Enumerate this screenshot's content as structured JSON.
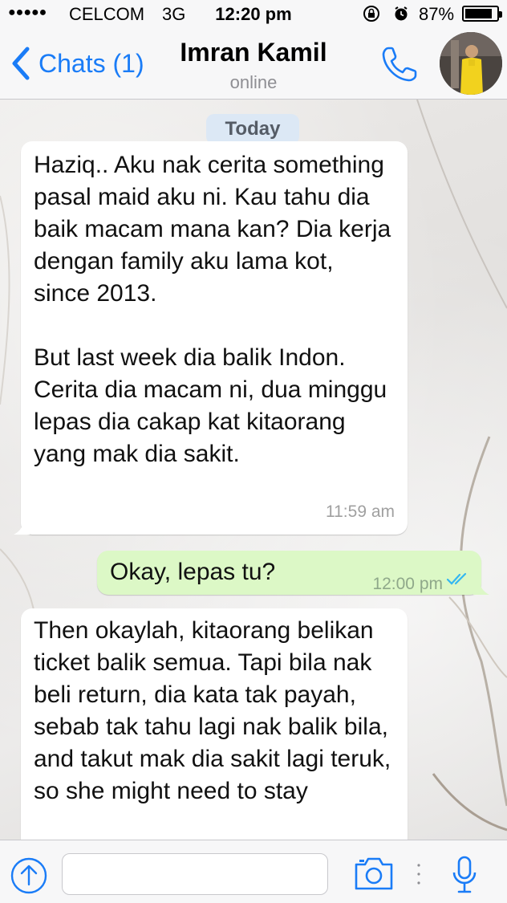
{
  "status_bar": {
    "signal": "●●●●●",
    "carrier": "CELCOM",
    "network": "3G",
    "time": "12:20 pm",
    "battery_percent": "87%",
    "battery_level": 0.87
  },
  "header": {
    "back_label": "Chats (1)",
    "contact_name": "Imran Kamil",
    "presence": "online",
    "icons": [
      "chevron-left-icon",
      "phone-icon",
      "avatar"
    ]
  },
  "chat": {
    "date_label": "Today",
    "messages": [
      {
        "direction": "incoming",
        "text": "Haziq.. Aku nak cerita something pasal maid aku ni. Kau tahu dia baik macam mana kan? Dia kerja dengan family aku lama kot, since 2013.\n\nBut last week dia balik Indon. Cerita dia macam ni, dua minggu lepas dia cakap kat kitaorang yang mak dia sakit.",
        "time": "11:59 am"
      },
      {
        "direction": "outgoing",
        "text": "Okay, lepas tu?",
        "time": "12:00 pm",
        "status": "read"
      },
      {
        "direction": "incoming",
        "text": "Then okaylah, kitaorang belikan ticket balik semua. Tapi bila nak beli return, dia kata tak payah, sebab tak tahu lagi nak balik bila, and takut mak dia sakit lagi teruk, so she might need to stay"
      }
    ]
  },
  "input_bar": {
    "message_value": "",
    "icons": [
      "share-icon",
      "camera-icon",
      "mic-icon"
    ]
  },
  "colors": {
    "accent": "#1a7cf7",
    "outgoing_bubble": "#dcf8c6",
    "incoming_bubble": "#ffffff",
    "date_pill": "#dce8f5",
    "read_ticks": "#34b7f1"
  }
}
